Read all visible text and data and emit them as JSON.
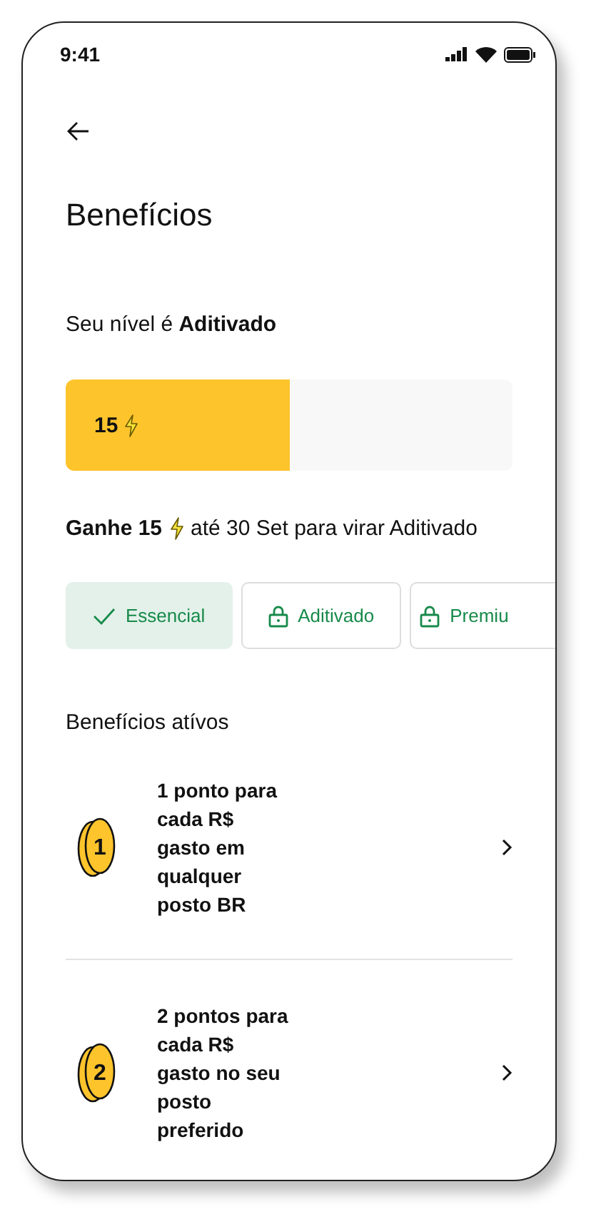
{
  "status_bar": {
    "time": "9:41"
  },
  "title": "Benefícios",
  "level_text": "Seu nível é **Aditivado**",
  "progress": {
    "label": "15",
    "level": 0.5
  },
  "goal": {
    "amount": "Ganhe 15",
    "rest": "até 30 Set para virar Aditivado"
  },
  "tiers": [
    {
      "label": "Essencial",
      "selected": true,
      "locked": false
    },
    {
      "label": "Aditivado",
      "selected": false,
      "locked": true
    },
    {
      "label": "Premiu",
      "selected": false,
      "locked": true
    }
  ],
  "section_title": "Benefícios atívos",
  "benefits": [
    {
      "coin": "1",
      "text": "1 ponto para cada R$ gasto em qualquer posto BR"
    },
    {
      "coin": "2",
      "text": "2 pontos para cada R$ gasto no seu posto preferido"
    }
  ]
}
